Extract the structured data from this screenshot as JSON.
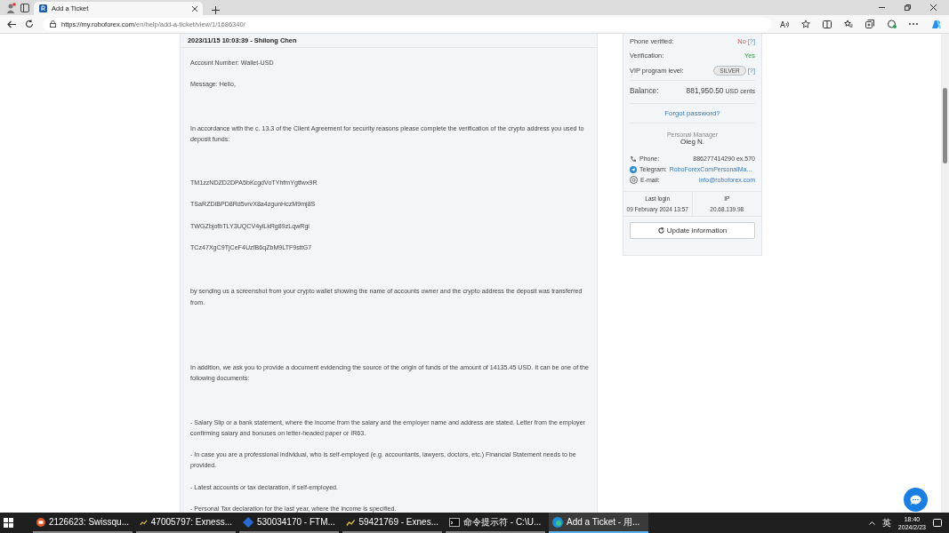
{
  "browser": {
    "tabs": [
      {
        "title": "Add a Ticket",
        "selected": true
      }
    ],
    "url_host": "https://my.roboforex.com",
    "url_path": "/en/help/add-a-ticket/view/1/1686340/"
  },
  "ticket": {
    "header": "2023/11/15 10:03:39 - Shilong Chen",
    "paragraphs": [
      {
        "kind": "text",
        "text": "Account Number: Wallet-USD"
      },
      {
        "kind": "text",
        "text": "Message: Hello,"
      },
      {
        "kind": "text",
        "text": "In accordance with the c. 13.3 of the Client Agreement for security reasons please complete the verification of the crypto address you used to deposit funds:"
      },
      {
        "kind": "text",
        "text": "TM1zzNDZD2DPA5bKcgdVoTYhfmYgtfwx9R"
      },
      {
        "kind": "text",
        "text": "TSaRZDiBPD8Rd5vrvX8a4zgunHczM9mj8S"
      },
      {
        "kind": "text",
        "text": "TWGZbjofbTLY3UQCV4yiLkRg89zLqwRgi"
      },
      {
        "kind": "text",
        "text": "TCz47XgC9TjCeF4UzfB6qZbM9LTF9sttG7"
      },
      {
        "kind": "text",
        "text": "by sending us a screenshot from your crypto wallet showing the name of accounts owner and the crypto address the deposit was transferred from."
      },
      {
        "kind": "text",
        "text": "In addition, we ask you to provide a document evidencing the source of the origin of funds of the amount of 14135.45 USD. It can be one of the following documents:"
      },
      {
        "kind": "text",
        "text": "- Salary Slip or a bank statement, where the income from the salary and the employer name and address are stated.  Letter from the employer confirming salary and bonuses on letter-headed paper or IR63."
      },
      {
        "kind": "text",
        "text": "- In case you are a professional individual, who is self-employed (e.g. accountants, lawyers, doctors, etc.) Financial Statement needs to be provided."
      },
      {
        "kind": "text",
        "text": "- Latest accounts or tax declaration, if self-employed."
      },
      {
        "kind": "text",
        "text": "- Personal Tax declaration for the last year, where the income is specified."
      }
    ]
  },
  "profile": {
    "rows": [
      {
        "label": "Phone verified:",
        "value": "No",
        "kind": "bad",
        "help": "[?]"
      },
      {
        "label": "Verification:",
        "value": "Yes",
        "kind": "good"
      },
      {
        "label": "VIP program level:",
        "value": "SILVER",
        "kind": "badge",
        "help": "[?]"
      }
    ],
    "balance_label": "Balance:",
    "balance_value": "881,950.50",
    "balance_unit": "USD cents",
    "forgot_link": "Forgot password?",
    "manager_title": "Personal Manager",
    "manager_name": "Oleg N.",
    "contacts": [
      {
        "kind": "phone",
        "label": "Phone:",
        "value": "886277414290 ex.570",
        "link": false
      },
      {
        "kind": "telegram",
        "label": "Telegram:",
        "value": "RoboForexComPersonalMa...",
        "link": true
      },
      {
        "kind": "email",
        "label": "E-mail:",
        "value": "info@roboforex.com",
        "link": true
      }
    ],
    "last_login_label": "Last login",
    "ip_label": "IP",
    "last_login": "09 February 2024 13:57",
    "ip": "20.68.139.98",
    "update_button": "Update information"
  },
  "taskbar": {
    "items": [
      {
        "title": "2126623: Swissqu...",
        "kind": "swiss",
        "selected": false
      },
      {
        "title": "47005797: Exness...",
        "kind": "chart",
        "selected": false
      },
      {
        "title": "530034170 - FTM...",
        "kind": "diamond",
        "selected": false
      },
      {
        "title": "59421769 - Exnes...",
        "kind": "chart",
        "selected": false
      },
      {
        "title": "命令提示符 - C:\\U...",
        "kind": "cmd",
        "selected": false
      },
      {
        "title": "Add a Ticket - 用...",
        "kind": "edge",
        "selected": true
      }
    ],
    "ime": "英",
    "time": "18:40",
    "date": "2024/2/23"
  }
}
